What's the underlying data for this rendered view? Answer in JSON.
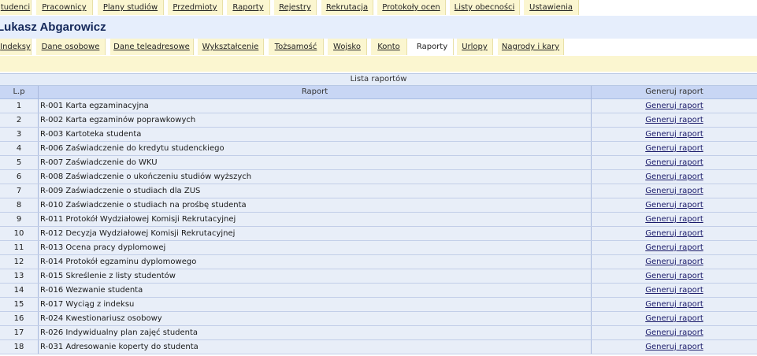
{
  "top_nav": [
    "tudenci",
    "Pracownicy",
    "Plany studiów",
    "Przedmioty",
    "Raporty",
    "Rejestry",
    "Rekrutacja",
    "Protokoły ocen",
    "Listy obecności",
    "Ustawienia"
  ],
  "student_name": "Lukasz Abgarowicz",
  "sub_tabs": [
    "Indeksy",
    "Dane osobowe",
    "Dane teleadresowe",
    "Wykształcenie",
    "Tożsamość",
    "Wojsko",
    "Konto",
    "Raporty",
    "Urlopy",
    "Nagrody i kary"
  ],
  "active_sub_tab": "Raporty",
  "table": {
    "caption": "Lista raportów",
    "headers": [
      "L.p",
      "Raport",
      "Generuj raport"
    ],
    "link_label": "Generuj raport",
    "rows": [
      {
        "lp": "1",
        "raport": "R-001 Karta egzaminacyjna"
      },
      {
        "lp": "2",
        "raport": "R-002 Karta egzaminów poprawkowych"
      },
      {
        "lp": "3",
        "raport": "R-003 Kartoteka studenta"
      },
      {
        "lp": "4",
        "raport": "R-006 Zaświadczenie do kredytu studenckiego"
      },
      {
        "lp": "5",
        "raport": "R-007 Zaświadczenie do WKU"
      },
      {
        "lp": "6",
        "raport": "R-008 Zaświadczenie o ukończeniu studiów wyższych"
      },
      {
        "lp": "7",
        "raport": "R-009 Zaświadczenie o studiach dla ZUS"
      },
      {
        "lp": "8",
        "raport": "R-010 Zaświadczenie o studiach na prośbę studenta"
      },
      {
        "lp": "9",
        "raport": "R-011 Protokół Wydziałowej Komisji Rekrutacyjnej"
      },
      {
        "lp": "10",
        "raport": "R-012 Decyzja Wydziałowej Komisji Rekrutacyjnej"
      },
      {
        "lp": "11",
        "raport": "R-013 Ocena pracy dyplomowej"
      },
      {
        "lp": "12",
        "raport": "R-014 Protokół egzaminu dyplomowego"
      },
      {
        "lp": "13",
        "raport": "R-015 Skreślenie z listy studentów"
      },
      {
        "lp": "14",
        "raport": "R-016 Wezwanie studenta"
      },
      {
        "lp": "15",
        "raport": "R-017 Wyciąg z indeksu"
      },
      {
        "lp": "16",
        "raport": "R-024 Kwestionariusz osobowy"
      },
      {
        "lp": "17",
        "raport": "R-026 Indywidualny plan zajęć studenta"
      },
      {
        "lp": "18",
        "raport": "R-031 Adresowanie koperty do studenta"
      }
    ]
  }
}
